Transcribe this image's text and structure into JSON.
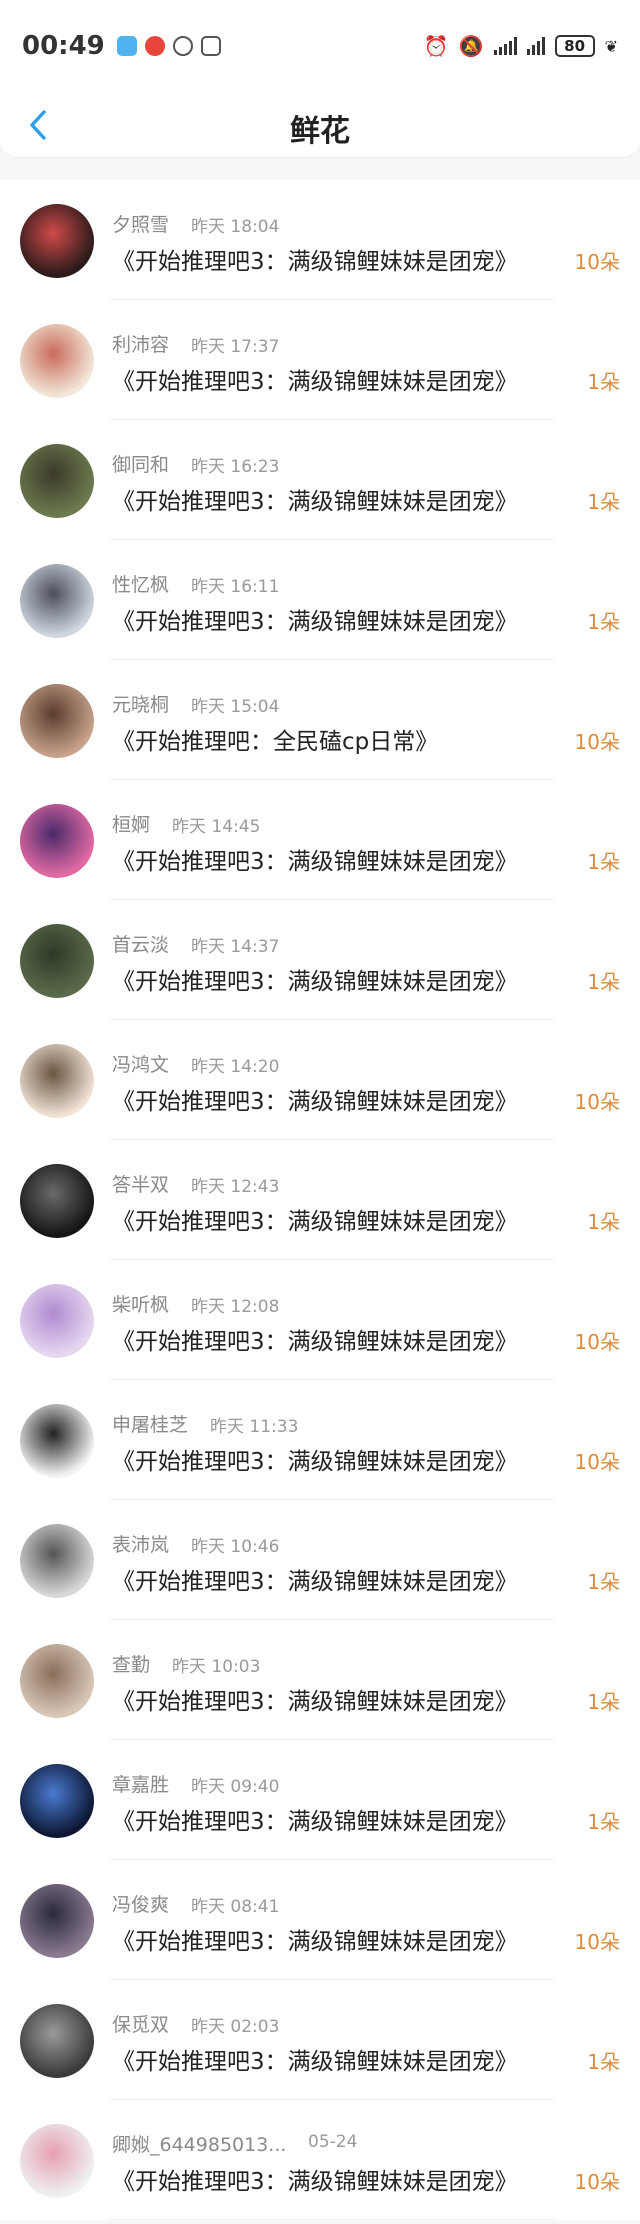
{
  "status_bar": {
    "time": "00:49",
    "battery": "80",
    "icons": [
      "bubble-app-icon",
      "weibo-app-icon",
      "tool-app-icon",
      "nfc-icon",
      "alarm-icon",
      "mute-icon",
      "signal-icon",
      "signal-icon"
    ]
  },
  "nav": {
    "title": "鲜花",
    "back_icon": "chevron-left-icon"
  },
  "colors": {
    "count": "#e08a3c",
    "back": "#2aa0e8"
  },
  "items": [
    {
      "name": "夕照雪",
      "time": "昨天 18:04",
      "book": "《开始推理吧3：满级锦鲤妹妹是团宠》",
      "count": "10朵"
    },
    {
      "name": "利沛容",
      "time": "昨天 17:37",
      "book": "《开始推理吧3：满级锦鲤妹妹是团宠》",
      "count": "1朵"
    },
    {
      "name": "御同和",
      "time": "昨天 16:23",
      "book": "《开始推理吧3：满级锦鲤妹妹是团宠》",
      "count": "1朵"
    },
    {
      "name": "性忆枫",
      "time": "昨天 16:11",
      "book": "《开始推理吧3：满级锦鲤妹妹是团宠》",
      "count": "1朵"
    },
    {
      "name": "元晓桐",
      "time": "昨天 15:04",
      "book": "《开始推理吧：全民磕cp日常》",
      "count": "10朵"
    },
    {
      "name": "桓婀",
      "time": "昨天 14:45",
      "book": "《开始推理吧3：满级锦鲤妹妹是团宠》",
      "count": "1朵"
    },
    {
      "name": "首云淡",
      "time": "昨天 14:37",
      "book": "《开始推理吧3：满级锦鲤妹妹是团宠》",
      "count": "1朵"
    },
    {
      "name": "冯鸿文",
      "time": "昨天 14:20",
      "book": "《开始推理吧3：满级锦鲤妹妹是团宠》",
      "count": "10朵"
    },
    {
      "name": "答半双",
      "time": "昨天 12:43",
      "book": "《开始推理吧3：满级锦鲤妹妹是团宠》",
      "count": "1朵"
    },
    {
      "name": "柴听枫",
      "time": "昨天 12:08",
      "book": "《开始推理吧3：满级锦鲤妹妹是团宠》",
      "count": "10朵"
    },
    {
      "name": "申屠桂芝",
      "time": "昨天 11:33",
      "book": "《开始推理吧3：满级锦鲤妹妹是团宠》",
      "count": "10朵"
    },
    {
      "name": "表沛岚",
      "time": "昨天 10:46",
      "book": "《开始推理吧3：满级锦鲤妹妹是团宠》",
      "count": "1朵"
    },
    {
      "name": "查勤",
      "time": "昨天 10:03",
      "book": "《开始推理吧3：满级锦鲤妹妹是团宠》",
      "count": "1朵"
    },
    {
      "name": "章嘉胜",
      "time": "昨天 09:40",
      "book": "《开始推理吧3：满级锦鲤妹妹是团宠》",
      "count": "1朵"
    },
    {
      "name": "冯俊爽",
      "time": "昨天 08:41",
      "book": "《开始推理吧3：满级锦鲤妹妹是团宠》",
      "count": "10朵"
    },
    {
      "name": "保觅双",
      "time": "昨天 02:03",
      "book": "《开始推理吧3：满级锦鲤妹妹是团宠》",
      "count": "1朵"
    },
    {
      "name": "卿娰_644985013...",
      "time": "05-24",
      "book": "《开始推理吧3：满级锦鲤妹妹是团宠》",
      "count": "10朵"
    }
  ]
}
